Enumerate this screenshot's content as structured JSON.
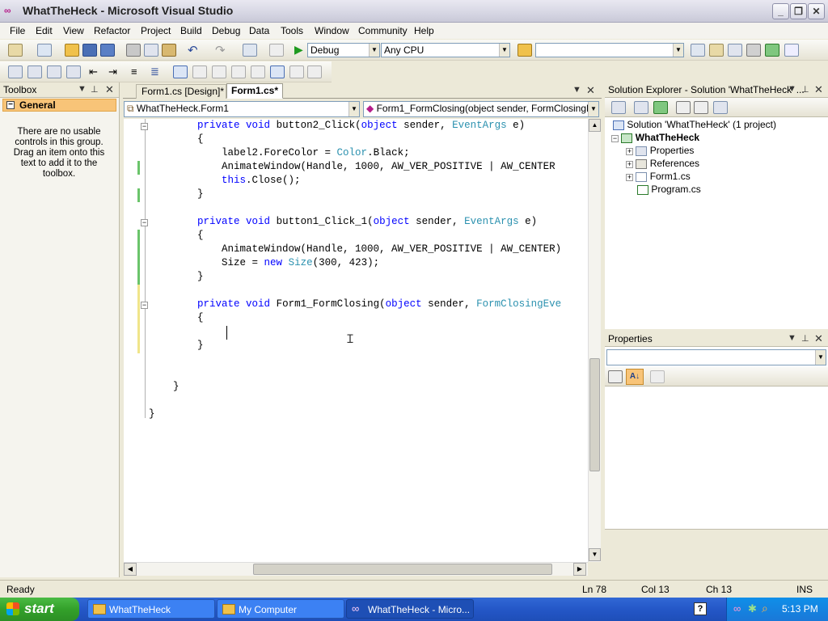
{
  "window": {
    "title": "WhatTheHeck - Microsoft Visual Studio"
  },
  "menus": [
    "File",
    "Edit",
    "View",
    "Refactor",
    "Project",
    "Build",
    "Debug",
    "Data",
    "Tools",
    "Window",
    "Community",
    "Help"
  ],
  "toolbar": {
    "configuration": "Debug",
    "platform": "Any CPU",
    "find_value": ""
  },
  "toolbox": {
    "title": "Toolbox",
    "group": "General",
    "empty_message": "There are no usable controls in this group. Drag an item onto this text to add it to the toolbox."
  },
  "editor": {
    "tabs": [
      {
        "label": "Form1.cs [Design]*",
        "active": false
      },
      {
        "label": "Form1.cs*",
        "active": true
      }
    ],
    "class_dropdown": "WhatTheHeck.Form1",
    "member_dropdown": "Form1_FormClosing(object sender, FormClosingEver"
  },
  "solution_explorer": {
    "title": "Solution Explorer - Solution 'WhatTheHeck' ...",
    "solution": "Solution 'WhatTheHeck' (1 project)",
    "project": "WhatTheHeck",
    "items": [
      "Properties",
      "References",
      "Form1.cs",
      "Program.cs"
    ]
  },
  "properties": {
    "title": "Properties"
  },
  "status": {
    "message": "Ready",
    "ln": "Ln 78",
    "col": "Col 13",
    "ch": "Ch 13",
    "mode": "INS"
  },
  "taskbar": {
    "start": "start",
    "tasks": [
      {
        "label": "WhatTheHeck"
      },
      {
        "label": "My Computer"
      },
      {
        "label": "WhatTheHeck - Micro..."
      }
    ],
    "clock": "5:13 PM"
  }
}
